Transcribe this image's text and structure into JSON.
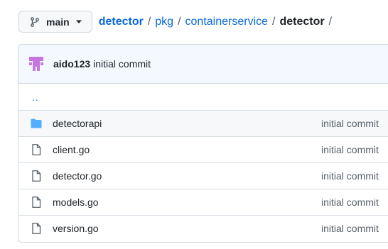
{
  "branch": {
    "label": "main"
  },
  "breadcrumb": {
    "parts": [
      "detector",
      "pkg",
      "containerservice"
    ],
    "current": "detector",
    "separator": "/"
  },
  "commit": {
    "author": "aido123",
    "message": "initial commit"
  },
  "parent_link": "..",
  "files": [
    {
      "name": "detectorapi",
      "type": "folder",
      "commit": "initial commit"
    },
    {
      "name": "client.go",
      "type": "file",
      "commit": "initial commit"
    },
    {
      "name": "detector.go",
      "type": "file",
      "commit": "initial commit"
    },
    {
      "name": "models.go",
      "type": "file",
      "commit": "initial commit"
    },
    {
      "name": "version.go",
      "type": "file",
      "commit": "initial commit"
    }
  ],
  "colors": {
    "link": "#0969da",
    "folder": "#54aeff",
    "avatar": "#c776e0"
  },
  "icons": {
    "branch": "git-branch-icon",
    "caret": "triangle-down-icon",
    "avatar": "identicon-avatar",
    "folder": "folder-icon",
    "file": "file-icon"
  }
}
